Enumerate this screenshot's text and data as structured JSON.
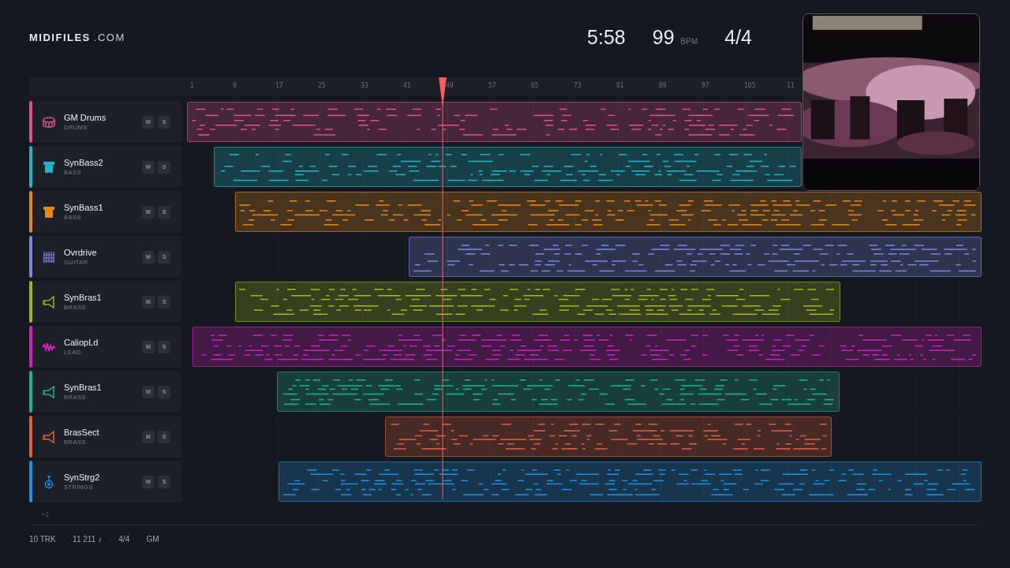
{
  "brand": {
    "name": "MIDIFILES",
    "suffix": ".COM"
  },
  "transport": {
    "time": "5:58",
    "tempo": "99",
    "tempo_unit": "BPM",
    "meter": "4/4"
  },
  "ruler": [
    "1",
    "9",
    "17",
    "25",
    "33",
    "41",
    "49",
    "57",
    "65",
    "73",
    "81",
    "89",
    "97",
    "105",
    "11"
  ],
  "tracks": [
    {
      "name": "GM Drums",
      "category": "DRUMS",
      "kind": "drums",
      "color": "#e0508a",
      "mute": "M",
      "solo": "S"
    },
    {
      "name": "SynBass2",
      "category": "BASS",
      "kind": "bass",
      "color": "#1fb5c9",
      "mute": "M",
      "solo": "S"
    },
    {
      "name": "SynBass1",
      "category": "BASS",
      "kind": "bass",
      "color": "#e8861a",
      "mute": "M",
      "solo": "S"
    },
    {
      "name": "Ovrdrive",
      "category": "GUITAR",
      "kind": "guitar",
      "color": "#7a86e0",
      "mute": "M",
      "solo": "S"
    },
    {
      "name": "SynBras1",
      "category": "BRASS",
      "kind": "brass",
      "color": "#a0b820",
      "mute": "M",
      "solo": "S"
    },
    {
      "name": "CaliopLd",
      "category": "LEAD",
      "kind": "lead",
      "color": "#d020c0",
      "mute": "M",
      "solo": "S"
    },
    {
      "name": "SynBras1",
      "category": "BRASS",
      "kind": "brass",
      "color": "#20b090",
      "mute": "M",
      "solo": "S"
    },
    {
      "name": "BrasSect",
      "category": "BRASS",
      "kind": "brass",
      "color": "#e06040",
      "mute": "M",
      "solo": "S"
    },
    {
      "name": "SynStrg2",
      "category": "STRINGS",
      "kind": "strings",
      "color": "#2090e0",
      "mute": "M",
      "solo": "S"
    }
  ],
  "more_tracks": "+1",
  "status_bar": [
    "10 TRK",
    "11 211 ♪",
    "4/4",
    "GM"
  ],
  "status_separator": "·"
}
